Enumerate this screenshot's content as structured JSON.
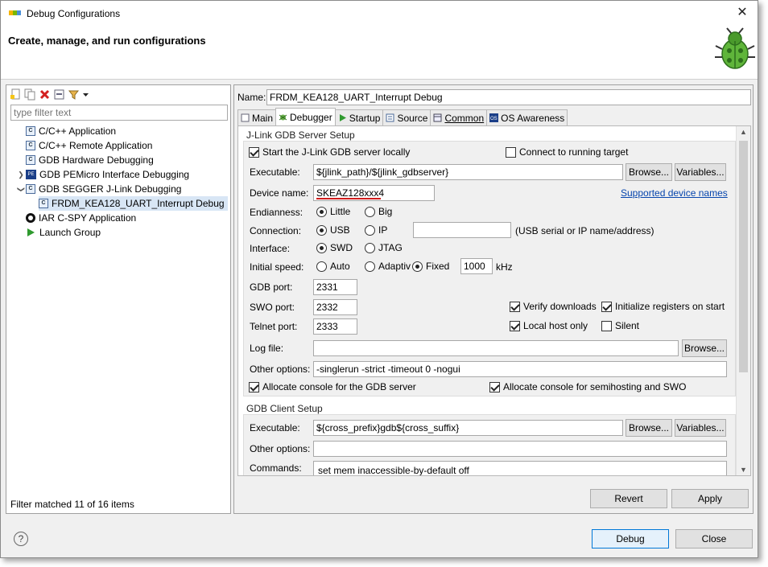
{
  "window": {
    "title": "Debug Configurations",
    "header_title": "Create, manage, and run configurations"
  },
  "left_panel": {
    "filter_placeholder": "type filter text",
    "tree": [
      {
        "label": "C/C++ Application",
        "icon": "c-config-icon"
      },
      {
        "label": "C/C++ Remote Application",
        "icon": "c-config-icon"
      },
      {
        "label": "GDB Hardware Debugging",
        "icon": "c-config-icon"
      },
      {
        "label": "GDB PEMicro Interface Debugging",
        "icon": "pemicro-icon",
        "expandable": true
      },
      {
        "label": "GDB SEGGER J-Link Debugging",
        "icon": "c-config-icon",
        "expanded": true
      },
      {
        "label": "FRDM_KEA128_UART_Interrupt Debug",
        "icon": "c-config-icon",
        "selected": true
      },
      {
        "label": "IAR C-SPY Application",
        "icon": "iar-icon"
      },
      {
        "label": "Launch Group",
        "icon": "launch-group-icon"
      }
    ],
    "status": "Filter matched 11 of 16 items"
  },
  "right_panel": {
    "name_label": "Name:",
    "name_value": "FRDM_KEA128_UART_Interrupt Debug",
    "tabs": [
      "Main",
      "Debugger",
      "Startup",
      "Source",
      "Common",
      "OS Awareness"
    ],
    "active_tab": "Debugger",
    "server": {
      "group_title": "J-Link GDB Server Setup",
      "start_locally": "Start the J-Link GDB server locally",
      "connect_running": "Connect to running target",
      "executable_label": "Executable:",
      "executable_value": "${jlink_path}/${jlink_gdbserver}",
      "browse": "Browse...",
      "variables": "Variables...",
      "device_label": "Device name:",
      "device_value": "SKEAZ128xxx4",
      "supported_link": "Supported device names",
      "endianness_label": "Endianness:",
      "little": "Little",
      "big": "Big",
      "connection_label": "Connection:",
      "usb": "USB",
      "ip": "IP",
      "ip_hint": "(USB serial or IP name/address)",
      "interface_label": "Interface:",
      "swd": "SWD",
      "jtag": "JTAG",
      "speed_label": "Initial speed:",
      "auto": "Auto",
      "adaptive": "Adaptiv",
      "fixed": "Fixed",
      "speed_value": "1000",
      "speed_unit": "kHz",
      "gdb_port_label": "GDB port:",
      "gdb_port": "2331",
      "swo_port_label": "SWO port:",
      "swo_port": "2332",
      "telnet_port_label": "Telnet port:",
      "telnet_port": "2333",
      "verify_downloads": "Verify downloads",
      "init_registers": "Initialize registers on start",
      "local_host_only": "Local host only",
      "silent": "Silent",
      "log_file_label": "Log file:",
      "other_options_label": "Other options:",
      "other_options_value": "-singlerun -strict -timeout 0 -nogui",
      "alloc_console_gdb": "Allocate console for the GDB server",
      "alloc_console_semi": "Allocate console for semihosting and SWO"
    },
    "client": {
      "group_title": "GDB Client Setup",
      "executable_label": "Executable:",
      "executable_value": "${cross_prefix}gdb${cross_suffix}",
      "other_options_label": "Other options:",
      "commands_label": "Commands:",
      "commands_value": "set mem inaccessible-by-default off"
    },
    "revert": "Revert",
    "apply": "Apply"
  },
  "footer": {
    "debug": "Debug",
    "close": "Close",
    "help": "?"
  },
  "colors": {
    "accent": "#0078d7",
    "selection": "#d8e6f5",
    "link": "#0645ad",
    "spell_error": "#d01c1c"
  }
}
